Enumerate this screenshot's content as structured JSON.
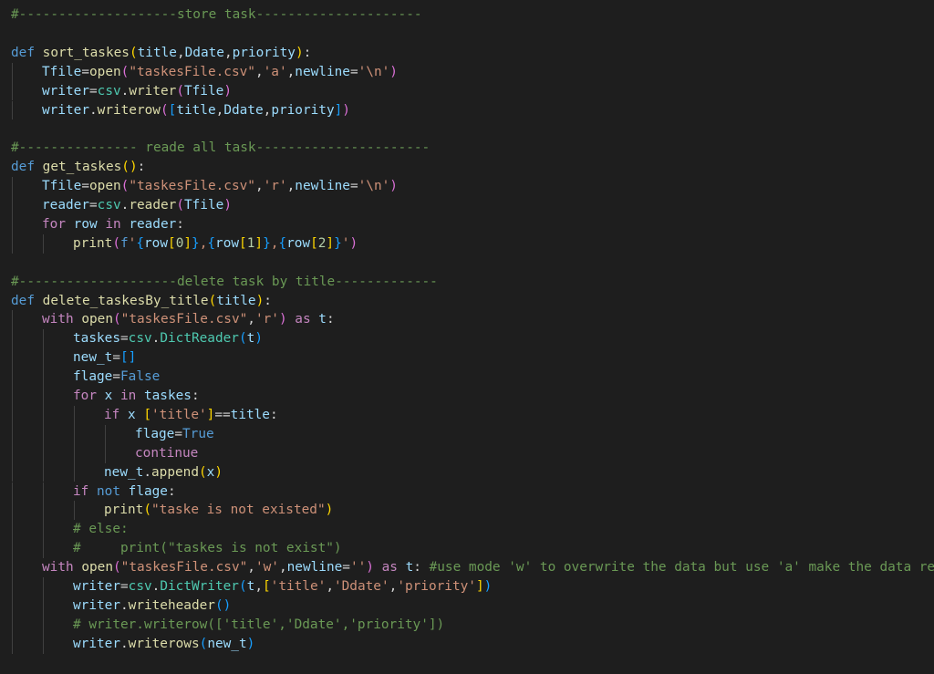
{
  "editor": {
    "lines": [
      {
        "indent": 0,
        "tokens": [
          [
            "comment",
            "#--------------------store task---------------------"
          ]
        ]
      },
      {
        "indent": 0,
        "tokens": []
      },
      {
        "indent": 0,
        "tokens": [
          [
            "keyword",
            "def "
          ],
          [
            "func",
            "sort_taskes"
          ],
          [
            "paren1",
            "("
          ],
          [
            "var",
            "title"
          ],
          [
            "plain",
            ","
          ],
          [
            "var",
            "Ddate"
          ],
          [
            "plain",
            ","
          ],
          [
            "var",
            "priority"
          ],
          [
            "paren1",
            ")"
          ],
          [
            "plain",
            ":"
          ]
        ]
      },
      {
        "indent": 1,
        "tokens": [
          [
            "var",
            "Tfile"
          ],
          [
            "plain",
            "="
          ],
          [
            "func",
            "open"
          ],
          [
            "paren2",
            "("
          ],
          [
            "string",
            "\"taskesFile.csv\""
          ],
          [
            "plain",
            ","
          ],
          [
            "string",
            "'a'"
          ],
          [
            "plain",
            ","
          ],
          [
            "var",
            "newline"
          ],
          [
            "plain",
            "="
          ],
          [
            "string",
            "'\\n'"
          ],
          [
            "paren2",
            ")"
          ]
        ]
      },
      {
        "indent": 1,
        "tokens": [
          [
            "var",
            "writer"
          ],
          [
            "plain",
            "="
          ],
          [
            "class",
            "csv"
          ],
          [
            "plain",
            "."
          ],
          [
            "func",
            "writer"
          ],
          [
            "paren2",
            "("
          ],
          [
            "var",
            "Tfile"
          ],
          [
            "paren2",
            ")"
          ]
        ]
      },
      {
        "indent": 1,
        "tokens": [
          [
            "var",
            "writer"
          ],
          [
            "plain",
            "."
          ],
          [
            "func",
            "writerow"
          ],
          [
            "paren2",
            "("
          ],
          [
            "paren3",
            "["
          ],
          [
            "var",
            "title"
          ],
          [
            "plain",
            ","
          ],
          [
            "var",
            "Ddate"
          ],
          [
            "plain",
            ","
          ],
          [
            "var",
            "priority"
          ],
          [
            "paren3",
            "]"
          ],
          [
            "paren2",
            ")"
          ]
        ]
      },
      {
        "indent": 0,
        "tokens": []
      },
      {
        "indent": 0,
        "tokens": [
          [
            "comment",
            "#--------------- reade all task----------------------"
          ]
        ]
      },
      {
        "indent": 0,
        "tokens": [
          [
            "keyword",
            "def "
          ],
          [
            "func",
            "get_taskes"
          ],
          [
            "paren1",
            "()"
          ],
          [
            "plain",
            ":"
          ]
        ]
      },
      {
        "indent": 1,
        "tokens": [
          [
            "var",
            "Tfile"
          ],
          [
            "plain",
            "="
          ],
          [
            "func",
            "open"
          ],
          [
            "paren2",
            "("
          ],
          [
            "string",
            "\"taskesFile.csv\""
          ],
          [
            "plain",
            ","
          ],
          [
            "string",
            "'r'"
          ],
          [
            "plain",
            ","
          ],
          [
            "var",
            "newline"
          ],
          [
            "plain",
            "="
          ],
          [
            "string",
            "'\\n'"
          ],
          [
            "paren2",
            ")"
          ]
        ]
      },
      {
        "indent": 1,
        "tokens": [
          [
            "var",
            "reader"
          ],
          [
            "plain",
            "="
          ],
          [
            "class",
            "csv"
          ],
          [
            "plain",
            "."
          ],
          [
            "func",
            "reader"
          ],
          [
            "paren2",
            "("
          ],
          [
            "var",
            "Tfile"
          ],
          [
            "paren2",
            ")"
          ]
        ]
      },
      {
        "indent": 1,
        "tokens": [
          [
            "control",
            "for "
          ],
          [
            "var",
            "row"
          ],
          [
            "control",
            " in "
          ],
          [
            "var",
            "reader"
          ],
          [
            "plain",
            ":"
          ]
        ]
      },
      {
        "indent": 2,
        "tokens": [
          [
            "func",
            "print"
          ],
          [
            "paren2",
            "("
          ],
          [
            "keyword",
            "f"
          ],
          [
            "string",
            "'"
          ],
          [
            "paren3",
            "{"
          ],
          [
            "var",
            "row"
          ],
          [
            "paren1",
            "["
          ],
          [
            "num",
            "0"
          ],
          [
            "paren1",
            "]"
          ],
          [
            "paren3",
            "}"
          ],
          [
            "string",
            ","
          ],
          [
            "paren3",
            "{"
          ],
          [
            "var",
            "row"
          ],
          [
            "paren1",
            "["
          ],
          [
            "num",
            "1"
          ],
          [
            "paren1",
            "]"
          ],
          [
            "paren3",
            "}"
          ],
          [
            "string",
            ","
          ],
          [
            "paren3",
            "{"
          ],
          [
            "var",
            "row"
          ],
          [
            "paren1",
            "["
          ],
          [
            "num",
            "2"
          ],
          [
            "paren1",
            "]"
          ],
          [
            "paren3",
            "}"
          ],
          [
            "string",
            "'"
          ],
          [
            "paren2",
            ")"
          ]
        ]
      },
      {
        "indent": 0,
        "tokens": []
      },
      {
        "indent": 0,
        "tokens": [
          [
            "comment",
            "#--------------------delete task by title-------------"
          ]
        ]
      },
      {
        "indent": 0,
        "tokens": [
          [
            "keyword",
            "def "
          ],
          [
            "func",
            "delete_taskesBy_title"
          ],
          [
            "paren1",
            "("
          ],
          [
            "var",
            "title"
          ],
          [
            "paren1",
            ")"
          ],
          [
            "plain",
            ":"
          ]
        ]
      },
      {
        "indent": 1,
        "tokens": [
          [
            "control",
            "with "
          ],
          [
            "func",
            "open"
          ],
          [
            "paren2",
            "("
          ],
          [
            "string",
            "\"taskesFile.csv\""
          ],
          [
            "plain",
            ","
          ],
          [
            "string",
            "'r'"
          ],
          [
            "paren2",
            ")"
          ],
          [
            "control",
            " as "
          ],
          [
            "var",
            "t"
          ],
          [
            "plain",
            ":"
          ]
        ]
      },
      {
        "indent": 2,
        "tokens": [
          [
            "var",
            "taskes"
          ],
          [
            "plain",
            "="
          ],
          [
            "class",
            "csv"
          ],
          [
            "plain",
            "."
          ],
          [
            "class",
            "DictReader"
          ],
          [
            "paren3",
            "("
          ],
          [
            "var",
            "t"
          ],
          [
            "paren3",
            ")"
          ]
        ]
      },
      {
        "indent": 2,
        "tokens": [
          [
            "var",
            "new_t"
          ],
          [
            "plain",
            "="
          ],
          [
            "paren3",
            "[]"
          ]
        ]
      },
      {
        "indent": 2,
        "tokens": [
          [
            "var",
            "flage"
          ],
          [
            "plain",
            "="
          ],
          [
            "const",
            "False"
          ]
        ]
      },
      {
        "indent": 2,
        "tokens": [
          [
            "control",
            "for "
          ],
          [
            "var",
            "x"
          ],
          [
            "control",
            " in "
          ],
          [
            "var",
            "taskes"
          ],
          [
            "plain",
            ":"
          ]
        ]
      },
      {
        "indent": 3,
        "tokens": [
          [
            "control",
            "if "
          ],
          [
            "var",
            "x "
          ],
          [
            "paren1",
            "["
          ],
          [
            "string",
            "'title'"
          ],
          [
            "paren1",
            "]"
          ],
          [
            "plain",
            "=="
          ],
          [
            "var",
            "title"
          ],
          [
            "plain",
            ":"
          ]
        ]
      },
      {
        "indent": 4,
        "tokens": [
          [
            "var",
            "flage"
          ],
          [
            "plain",
            "="
          ],
          [
            "const",
            "True"
          ]
        ]
      },
      {
        "indent": 4,
        "tokens": [
          [
            "control",
            "continue"
          ]
        ]
      },
      {
        "indent": 3,
        "tokens": [
          [
            "var",
            "new_t"
          ],
          [
            "plain",
            "."
          ],
          [
            "func",
            "append"
          ],
          [
            "paren1",
            "("
          ],
          [
            "var",
            "x"
          ],
          [
            "paren1",
            ")"
          ]
        ]
      },
      {
        "indent": 2,
        "tokens": [
          [
            "control",
            "if "
          ],
          [
            "keyword",
            "not "
          ],
          [
            "var",
            "flage"
          ],
          [
            "plain",
            ":"
          ]
        ]
      },
      {
        "indent": 3,
        "tokens": [
          [
            "func",
            "print"
          ],
          [
            "paren1",
            "("
          ],
          [
            "string",
            "\"taske is not existed\""
          ],
          [
            "paren1",
            ")"
          ]
        ]
      },
      {
        "indent": 2,
        "tokens": [
          [
            "comment",
            "# else:"
          ]
        ]
      },
      {
        "indent": 2,
        "tokens": [
          [
            "comment",
            "#     print(\"taskes is not exist\")"
          ]
        ]
      },
      {
        "indent": 1,
        "tokens": [
          [
            "control",
            "with "
          ],
          [
            "func",
            "open"
          ],
          [
            "paren2",
            "("
          ],
          [
            "string",
            "\"taskesFile.csv\""
          ],
          [
            "plain",
            ","
          ],
          [
            "string",
            "'w'"
          ],
          [
            "plain",
            ","
          ],
          [
            "var",
            "newline"
          ],
          [
            "plain",
            "="
          ],
          [
            "string",
            "''"
          ],
          [
            "paren2",
            ")"
          ],
          [
            "control",
            " as "
          ],
          [
            "var",
            "t"
          ],
          [
            "plain",
            ": "
          ],
          [
            "comment",
            "#use mode 'w' to overwrite the data but use 'a' make the data reap"
          ]
        ]
      },
      {
        "indent": 2,
        "tokens": [
          [
            "var",
            "writer"
          ],
          [
            "plain",
            "="
          ],
          [
            "class",
            "csv"
          ],
          [
            "plain",
            "."
          ],
          [
            "class",
            "DictWriter"
          ],
          [
            "paren3",
            "("
          ],
          [
            "var",
            "t"
          ],
          [
            "plain",
            ","
          ],
          [
            "paren1",
            "["
          ],
          [
            "string",
            "'title'"
          ],
          [
            "plain",
            ","
          ],
          [
            "string",
            "'Ddate'"
          ],
          [
            "plain",
            ","
          ],
          [
            "string",
            "'priority'"
          ],
          [
            "paren1",
            "]"
          ],
          [
            "paren3",
            ")"
          ]
        ]
      },
      {
        "indent": 2,
        "tokens": [
          [
            "var",
            "writer"
          ],
          [
            "plain",
            "."
          ],
          [
            "func",
            "writeheader"
          ],
          [
            "paren3",
            "()"
          ]
        ]
      },
      {
        "indent": 2,
        "tokens": [
          [
            "comment",
            "# writer.writerow(['title','Ddate','priority'])"
          ]
        ]
      },
      {
        "indent": 2,
        "tokens": [
          [
            "var",
            "writer"
          ],
          [
            "plain",
            "."
          ],
          [
            "func",
            "writerows"
          ],
          [
            "paren3",
            "("
          ],
          [
            "var",
            "new_t"
          ],
          [
            "paren3",
            ")"
          ]
        ]
      }
    ]
  }
}
